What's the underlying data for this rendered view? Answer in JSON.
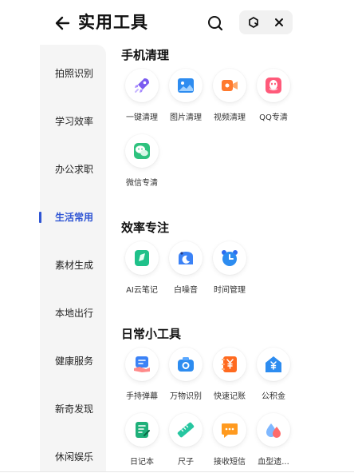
{
  "header": {
    "title": "实用工具"
  },
  "icons": {
    "back": "arrow-left-icon",
    "search": "search-icon",
    "refresh": "refresh-icon",
    "close": "close-icon"
  },
  "colors": {
    "accent": "#2f55d4",
    "sidebar_bg": "#f5f5f5"
  },
  "sidebar": {
    "items": [
      {
        "label": "拍照识别"
      },
      {
        "label": "学习效率"
      },
      {
        "label": "办公求职"
      },
      {
        "label": "生活常用",
        "active": true
      },
      {
        "label": "素材生成"
      },
      {
        "label": "本地出行"
      },
      {
        "label": "健康服务"
      },
      {
        "label": "新奇发现"
      },
      {
        "label": "休闲娱乐"
      }
    ]
  },
  "sections": [
    {
      "title": "手机清理",
      "tools": [
        {
          "label": "一键清理",
          "icon": "rocket-icon"
        },
        {
          "label": "图片清理",
          "icon": "image-icon"
        },
        {
          "label": "视频清理",
          "icon": "video-icon"
        },
        {
          "label": "QQ专清",
          "icon": "qq-icon"
        },
        {
          "label": "微信专清",
          "icon": "wechat-icon"
        }
      ]
    },
    {
      "title": "效率专注",
      "tools": [
        {
          "label": "AI云笔记",
          "icon": "note-icon"
        },
        {
          "label": "白噪音",
          "icon": "moon-icon"
        },
        {
          "label": "时间管理",
          "icon": "alarm-clock-icon"
        }
      ]
    },
    {
      "title": "日常小工具",
      "tools": [
        {
          "label": "手持弹幕",
          "icon": "hand-banner-icon"
        },
        {
          "label": "万物识别",
          "icon": "camera-icon"
        },
        {
          "label": "快速记账",
          "icon": "yuan-book-icon"
        },
        {
          "label": "公积金",
          "icon": "house-fund-icon"
        },
        {
          "label": "日记本",
          "icon": "diary-icon"
        },
        {
          "label": "尺子",
          "icon": "ruler-icon"
        },
        {
          "label": "接收短信",
          "icon": "sms-icon"
        },
        {
          "label": "血型遗...",
          "icon": "blood-drop-icon"
        }
      ]
    }
  ]
}
